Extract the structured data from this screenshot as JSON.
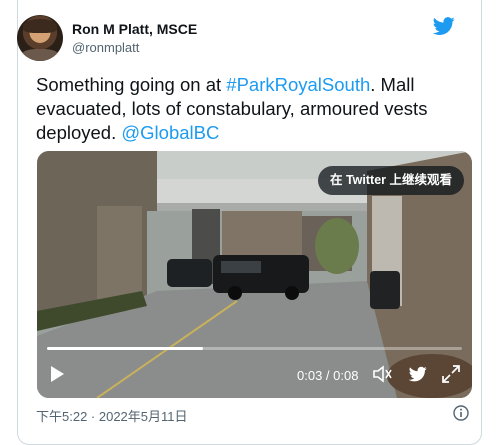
{
  "author": {
    "name": "Ron M Platt, MSCE",
    "handle": "@ronmplatt"
  },
  "tweet": {
    "text_part1": "Something going on at ",
    "hashtag": "#ParkRoyalSouth",
    "text_part2": ". Mall evacuated, lots of constabulary, armoured vests deployed. ",
    "mention": "@GlobalBC"
  },
  "media": {
    "watch_label": "在 Twitter 上继续观看",
    "current_time": "0:03",
    "duration": "0:08",
    "progress_fraction": 0.375
  },
  "footer": {
    "timestamp": "下午5:22 · 2022年5月11日"
  },
  "icons": {
    "brand": "twitter-bird-icon",
    "play": "play-icon",
    "volume": "volume-icon",
    "fullscreen": "fullscreen-icon",
    "info": "info-icon"
  },
  "colors": {
    "accent": "#1d9bf0",
    "text": "#0f1419",
    "muted": "#536471"
  }
}
